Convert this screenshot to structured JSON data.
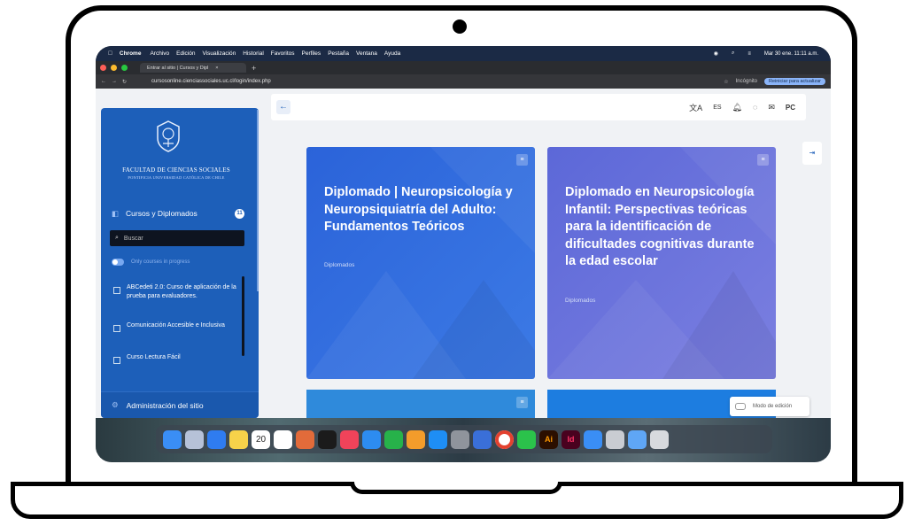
{
  "menubar": {
    "items": [
      "Chrome",
      "Archivo",
      "Edición",
      "Visualización",
      "Historial",
      "Favoritos",
      "Perfiles",
      "Pestaña",
      "Ventana",
      "Ayuda"
    ],
    "datetime": "Mar 30 ene. 11:11 a.m."
  },
  "browser": {
    "tab_title": "Entrar al sitio | Cursos y Dipl",
    "url": "cursosonline.cienciassociales.uc.cl/login/index.php",
    "incognito": "Incógnito",
    "reload_label": "Reiniciar para actualizar"
  },
  "sidebar": {
    "faculty": "FACULTAD DE CIENCIAS SOCIALES",
    "university": "PONTIFICIA UNIVERSIDAD CATÓLICA DE CHILE",
    "section_title": "Cursos y Diplomados",
    "section_count": "11",
    "search_placeholder": "Buscar",
    "toggle_label": "Only courses in progress",
    "courses": [
      "ABCedeti 2.0: Curso de aplicación de la prueba para evaluadores.",
      "Comunicación Accesible e Inclusiva",
      "Curso Lectura Fácil"
    ],
    "admin_label": "Administración del sitio"
  },
  "header": {
    "lang": "ES",
    "avatar": "PC"
  },
  "cards": [
    {
      "title": "Diplomado | Neuropsicología y Neuropsiquiatría del Adulto: Fundamentos Teóricos",
      "category": "Diplomados",
      "color": "#2b63d9"
    },
    {
      "title": "Diplomado en Neuropsicología Infantil: Perspectivas teóricas para la identificación de dificultades cognitivas durante la edad escolar",
      "category": "Diplomados",
      "color": "#6b73dc"
    }
  ],
  "edit_mode_label": "Modo de edición",
  "dock_icons": [
    "finder-icon",
    "launchpad-icon",
    "mail-icon",
    "notes-icon",
    "calendar-icon",
    "reminders-icon",
    "photos-icon",
    "appletv-icon",
    "music-icon",
    "keynote-icon",
    "numbers-icon",
    "pages-icon",
    "appstore-icon",
    "settings-icon",
    "notepad-icon",
    "chrome-icon",
    "whatsapp-icon",
    "illustrator-icon",
    "indesign-icon",
    "finder2-icon",
    "printer-icon",
    "downloads-icon",
    "trash-icon"
  ],
  "calendar_day": "20"
}
